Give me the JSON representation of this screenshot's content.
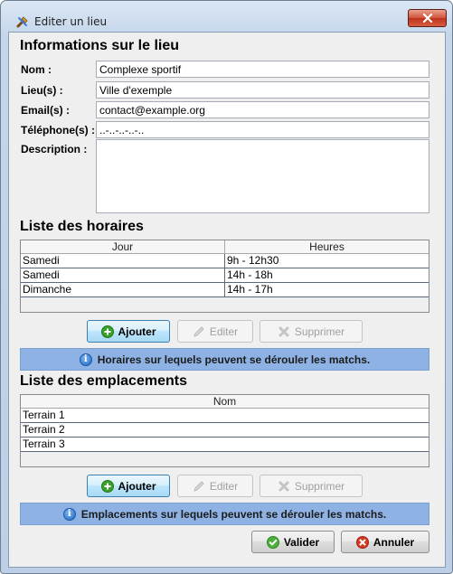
{
  "window": {
    "title": "Editer un lieu"
  },
  "info_section": {
    "title": "Informations sur le lieu",
    "fields": {
      "nom": {
        "label": "Nom :",
        "value": "Complexe sportif"
      },
      "lieu": {
        "label": "Lieu(s) :",
        "value": "Ville d'exemple"
      },
      "email": {
        "label": "Email(s) :",
        "value": "contact@example.org"
      },
      "telephone": {
        "label": "Téléphone(s) :",
        "value": "..-..-..-..-.."
      },
      "description": {
        "label": "Description :",
        "value": ""
      }
    }
  },
  "horaires": {
    "title": "Liste des horaires",
    "columns": [
      "Jour",
      "Heures"
    ],
    "rows": [
      [
        "Samedi",
        "9h - 12h30"
      ],
      [
        "Samedi",
        "14h - 18h"
      ],
      [
        "Dimanche",
        "14h - 17h"
      ]
    ],
    "buttons": {
      "add": "Ajouter",
      "edit": "Editer",
      "delete": "Supprimer"
    },
    "info": "Horaires sur lequels peuvent se dérouler les matchs."
  },
  "emplacements": {
    "title": "Liste des emplacements",
    "columns": [
      "Nom"
    ],
    "rows": [
      [
        "Terrain 1"
      ],
      [
        "Terrain 2"
      ],
      [
        "Terrain 3"
      ]
    ],
    "buttons": {
      "add": "Ajouter",
      "edit": "Editer",
      "delete": "Supprimer"
    },
    "info": "Emplacements sur lequels peuvent se dérouler les matchs."
  },
  "footer": {
    "validate": "Valider",
    "cancel": "Annuler"
  },
  "colors": {
    "info_bar": "#8db2e3",
    "add_icon": "#3aa02a",
    "validate_icon": "#4caf3a",
    "cancel_icon": "#d23a22",
    "close_button": "#c9432c"
  },
  "icons": {
    "app": "tools-icon",
    "add": "plus-circle-icon",
    "edit": "pencil-icon",
    "delete": "x-icon",
    "info": "info-icon",
    "validate": "check-circle-icon",
    "cancel": "x-circle-icon",
    "close": "close-icon"
  }
}
